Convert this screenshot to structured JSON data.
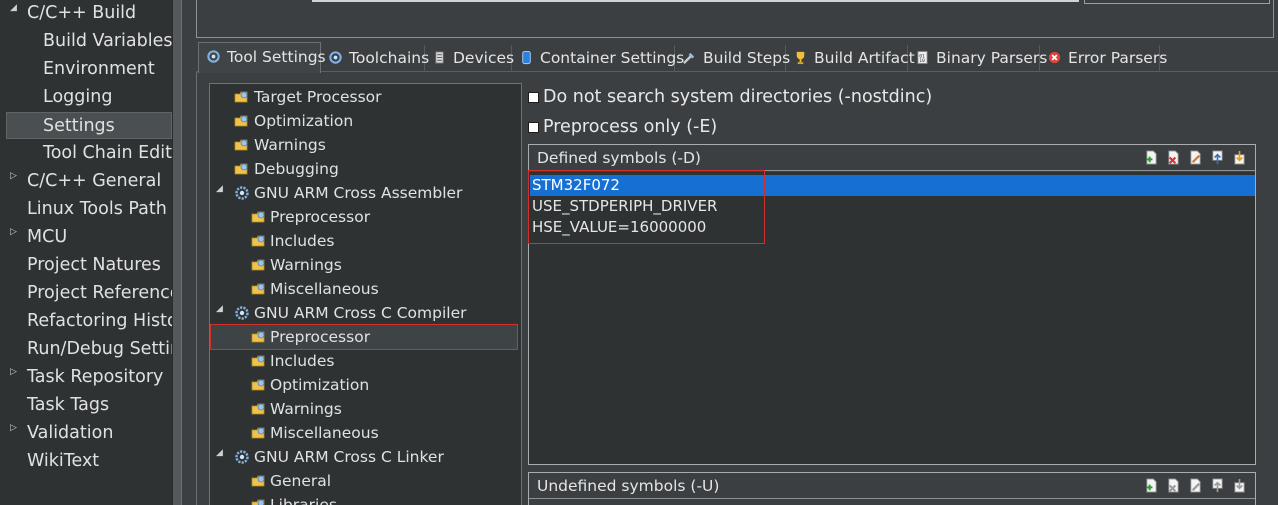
{
  "left_nav": {
    "items": [
      {
        "label": "C/C++ Build",
        "indent": 0,
        "twisty": "expanded"
      },
      {
        "label": "Build Variables",
        "indent": 1,
        "twisty": "none"
      },
      {
        "label": "Environment",
        "indent": 1,
        "twisty": "none"
      },
      {
        "label": "Logging",
        "indent": 1,
        "twisty": "none"
      },
      {
        "label": "Settings",
        "indent": 1,
        "twisty": "none",
        "selected": true
      },
      {
        "label": "Tool Chain Editor",
        "indent": 1,
        "twisty": "none"
      },
      {
        "label": "C/C++ General",
        "indent": 0,
        "twisty": "collapsed"
      },
      {
        "label": "Linux Tools Path",
        "indent": 0,
        "twisty": "none"
      },
      {
        "label": "MCU",
        "indent": 0,
        "twisty": "collapsed"
      },
      {
        "label": "Project Natures",
        "indent": 0,
        "twisty": "none"
      },
      {
        "label": "Project References",
        "indent": 0,
        "twisty": "none"
      },
      {
        "label": "Refactoring History",
        "indent": 0,
        "twisty": "none"
      },
      {
        "label": "Run/Debug Settings",
        "indent": 0,
        "twisty": "none"
      },
      {
        "label": "Task Repository",
        "indent": 0,
        "twisty": "collapsed"
      },
      {
        "label": "Task Tags",
        "indent": 0,
        "twisty": "none"
      },
      {
        "label": "Validation",
        "indent": 0,
        "twisty": "collapsed"
      },
      {
        "label": "WikiText",
        "indent": 0,
        "twisty": "none"
      }
    ]
  },
  "tabs": [
    {
      "label": "Tool Settings",
      "icon": "tool-settings-icon",
      "active": true
    },
    {
      "label": "Toolchains",
      "icon": "toolchains-icon"
    },
    {
      "label": "Devices",
      "icon": "devices-icon"
    },
    {
      "label": "Container Settings",
      "icon": "container-icon"
    },
    {
      "label": "Build Steps",
      "icon": "build-steps-icon"
    },
    {
      "label": "Build Artifact",
      "icon": "build-artifact-icon"
    },
    {
      "label": "Binary Parsers",
      "icon": "binary-parsers-icon"
    },
    {
      "label": "Error Parsers",
      "icon": "error-parsers-icon"
    }
  ],
  "settings_tree": {
    "items": [
      {
        "label": "Target Processor",
        "kind": "option",
        "level": 0
      },
      {
        "label": "Optimization",
        "kind": "option",
        "level": 0
      },
      {
        "label": "Warnings",
        "kind": "option",
        "level": 0
      },
      {
        "label": "Debugging",
        "kind": "option",
        "level": 0
      },
      {
        "label": "GNU ARM Cross Assembler",
        "kind": "tool",
        "level": 0
      },
      {
        "label": "Preprocessor",
        "kind": "option",
        "level": 1
      },
      {
        "label": "Includes",
        "kind": "option",
        "level": 1
      },
      {
        "label": "Warnings",
        "kind": "option",
        "level": 1
      },
      {
        "label": "Miscellaneous",
        "kind": "option",
        "level": 1
      },
      {
        "label": "GNU ARM Cross C Compiler",
        "kind": "tool",
        "level": 0
      },
      {
        "label": "Preprocessor",
        "kind": "option",
        "level": 1,
        "selected": true
      },
      {
        "label": "Includes",
        "kind": "option",
        "level": 1
      },
      {
        "label": "Optimization",
        "kind": "option",
        "level": 1
      },
      {
        "label": "Warnings",
        "kind": "option",
        "level": 1
      },
      {
        "label": "Miscellaneous",
        "kind": "option",
        "level": 1
      },
      {
        "label": "GNU ARM Cross C Linker",
        "kind": "tool",
        "level": 0
      },
      {
        "label": "General",
        "kind": "option",
        "level": 1
      },
      {
        "label": "Libraries",
        "kind": "option",
        "level": 1
      }
    ]
  },
  "options": {
    "nostdinc_label": "Do not search system directories (-nostdinc)",
    "nostdinc_checked": false,
    "preprocess_only_label": "Preprocess only (-E)",
    "preprocess_only_checked": false
  },
  "defined_symbols": {
    "title": "Defined symbols (-D)",
    "tools": [
      "add-icon",
      "delete-icon",
      "edit-icon",
      "move-up-icon",
      "move-down-icon"
    ],
    "values": [
      "STM32F072",
      "USE_STDPERIPH_DRIVER",
      "HSE_VALUE=16000000"
    ],
    "selected_index": 0
  },
  "undefined_symbols": {
    "title": "Undefined symbols (-U)",
    "tools": [
      "add-icon",
      "delete-icon",
      "edit-icon",
      "move-up-icon",
      "move-down-icon"
    ]
  },
  "colors": {
    "selection": "#1670d4",
    "highlight_outline": "#d0312d",
    "panel_bg": "#2f3233",
    "window_bg": "#3b3f42"
  }
}
